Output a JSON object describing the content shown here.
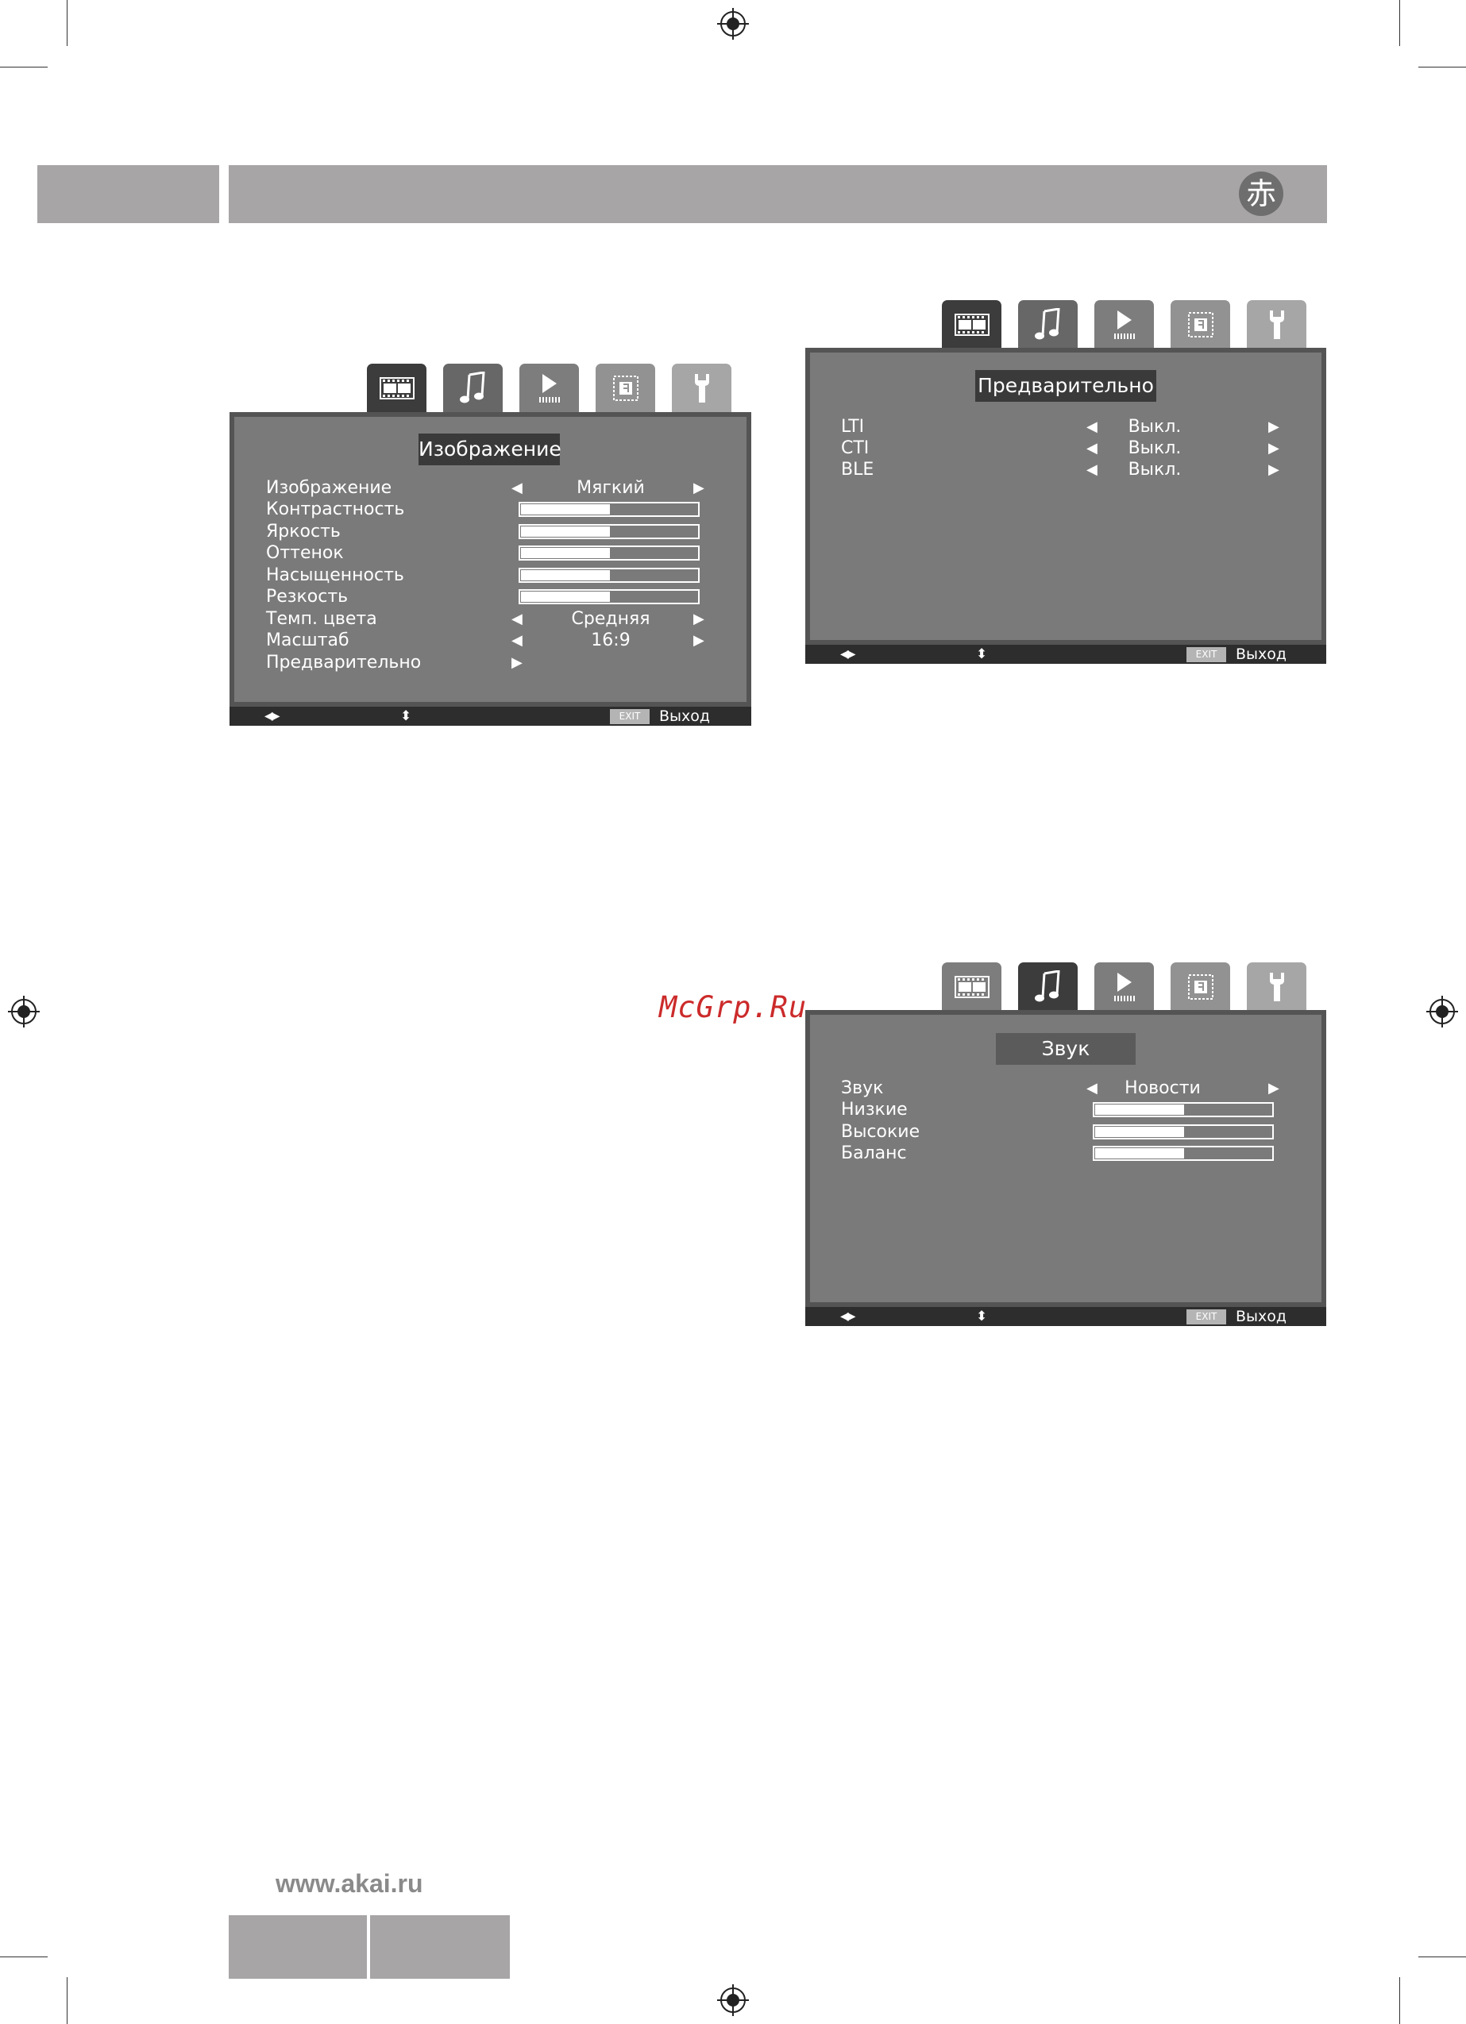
{
  "brand": {
    "logo_glyph": "赤"
  },
  "watermark": "McGrp.Ru",
  "footer": {
    "website": "www.akai.ru"
  },
  "tabs": [
    "picture-icon",
    "music-icon",
    "play-icon",
    "screen-icon",
    "wrench-icon"
  ],
  "picture_menu": {
    "title": "Изображение",
    "rows": [
      {
        "label": "Изображение",
        "value": "Мягкий"
      },
      {
        "label": "Контрастность",
        "level": 0.5
      },
      {
        "label": "Яркость",
        "level": 0.5
      },
      {
        "label": "Оттенок",
        "level": 0.5
      },
      {
        "label": "Насыщенность",
        "level": 0.5
      },
      {
        "label": "Резкость",
        "level": 0.5
      },
      {
        "label": "Темп. цвета",
        "value": "Средняя"
      },
      {
        "label": "Масштаб",
        "value": "16:9"
      },
      {
        "label": "Предварительно"
      }
    ],
    "exit_key": "EXIT",
    "exit_label": "Выход"
  },
  "advanced_menu": {
    "title": "Предварительно",
    "rows": [
      {
        "label": "LTI",
        "value": "Выкл."
      },
      {
        "label": "CTI",
        "value": "Выкл."
      },
      {
        "label": "BLE",
        "value": "Выкл."
      }
    ],
    "exit_key": "EXIT",
    "exit_label": "Выход"
  },
  "sound_menu": {
    "title": "Звук",
    "rows": [
      {
        "label": "Звук",
        "value": "Новости"
      },
      {
        "label": "Низкие",
        "level": 0.5
      },
      {
        "label": "Высокие",
        "level": 0.5
      },
      {
        "label": "Баланс",
        "level": 0.5
      }
    ],
    "exit_key": "EXIT",
    "exit_label": "Выход"
  },
  "glyphs": {
    "left": "◀",
    "right": "▶",
    "lr": "◀▶",
    "ud": "⬍"
  }
}
